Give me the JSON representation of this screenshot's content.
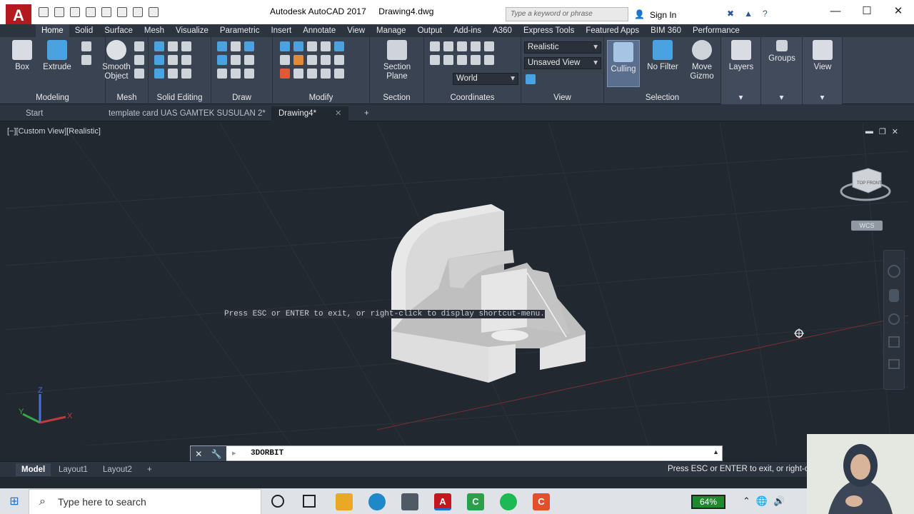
{
  "app": {
    "title": "Autodesk AutoCAD 2017",
    "document": "Drawing4.dwg",
    "search_placeholder": "Type a keyword or phrase",
    "sign_in": "Sign In",
    "logo_letter": "A"
  },
  "ribbon_tabs": [
    "Home",
    "Solid",
    "Surface",
    "Mesh",
    "Visualize",
    "Parametric",
    "Insert",
    "Annotate",
    "View",
    "Manage",
    "Output",
    "Add-ins",
    "A360",
    "Express Tools",
    "Featured Apps",
    "BIM 360",
    "Performance"
  ],
  "ribbon": {
    "box": "Box",
    "extrude": "Extrude",
    "smooth_object_1": "Smooth",
    "smooth_object_2": "Object",
    "section_plane_1": "Section",
    "section_plane_2": "Plane",
    "visual_style": "Realistic",
    "named_view": "Unsaved View",
    "ucs": "World",
    "culling": "Culling",
    "no_filter": "No Filter",
    "move_gizmo_1": "Move",
    "move_gizmo_2": "Gizmo",
    "layers": "Layers",
    "groups": "Groups",
    "view": "View",
    "panels": {
      "modeling": "Modeling",
      "mesh": "Mesh",
      "solid_editing": "Solid Editing",
      "draw": "Draw",
      "modify": "Modify",
      "section": "Section",
      "coordinates": "Coordinates",
      "view": "View",
      "selection": "Selection"
    }
  },
  "file_tabs": [
    "Start",
    "template card UAS GAMTEK SUSULAN 2*",
    "Drawing4*"
  ],
  "viewport": {
    "label": "[−][Custom View][Realistic]",
    "wcs": "WCS",
    "viewcube_top": "TOP",
    "viewcube_front": "FRONT"
  },
  "hint": "Press ESC or ENTER to exit, or right-click to display shortcut-menu.",
  "command": "3DORBIT",
  "layout_tabs": [
    "Model",
    "Layout1",
    "Layout2"
  ],
  "status_message": "Press ESC or ENTER to exit, or right-clic",
  "taskbar": {
    "search_placeholder": "Type here to search",
    "battery": "64%"
  },
  "colors": {
    "viewport_bg": "#212830",
    "ribbon_bg": "#3a4352",
    "accent": "#b3191e"
  }
}
